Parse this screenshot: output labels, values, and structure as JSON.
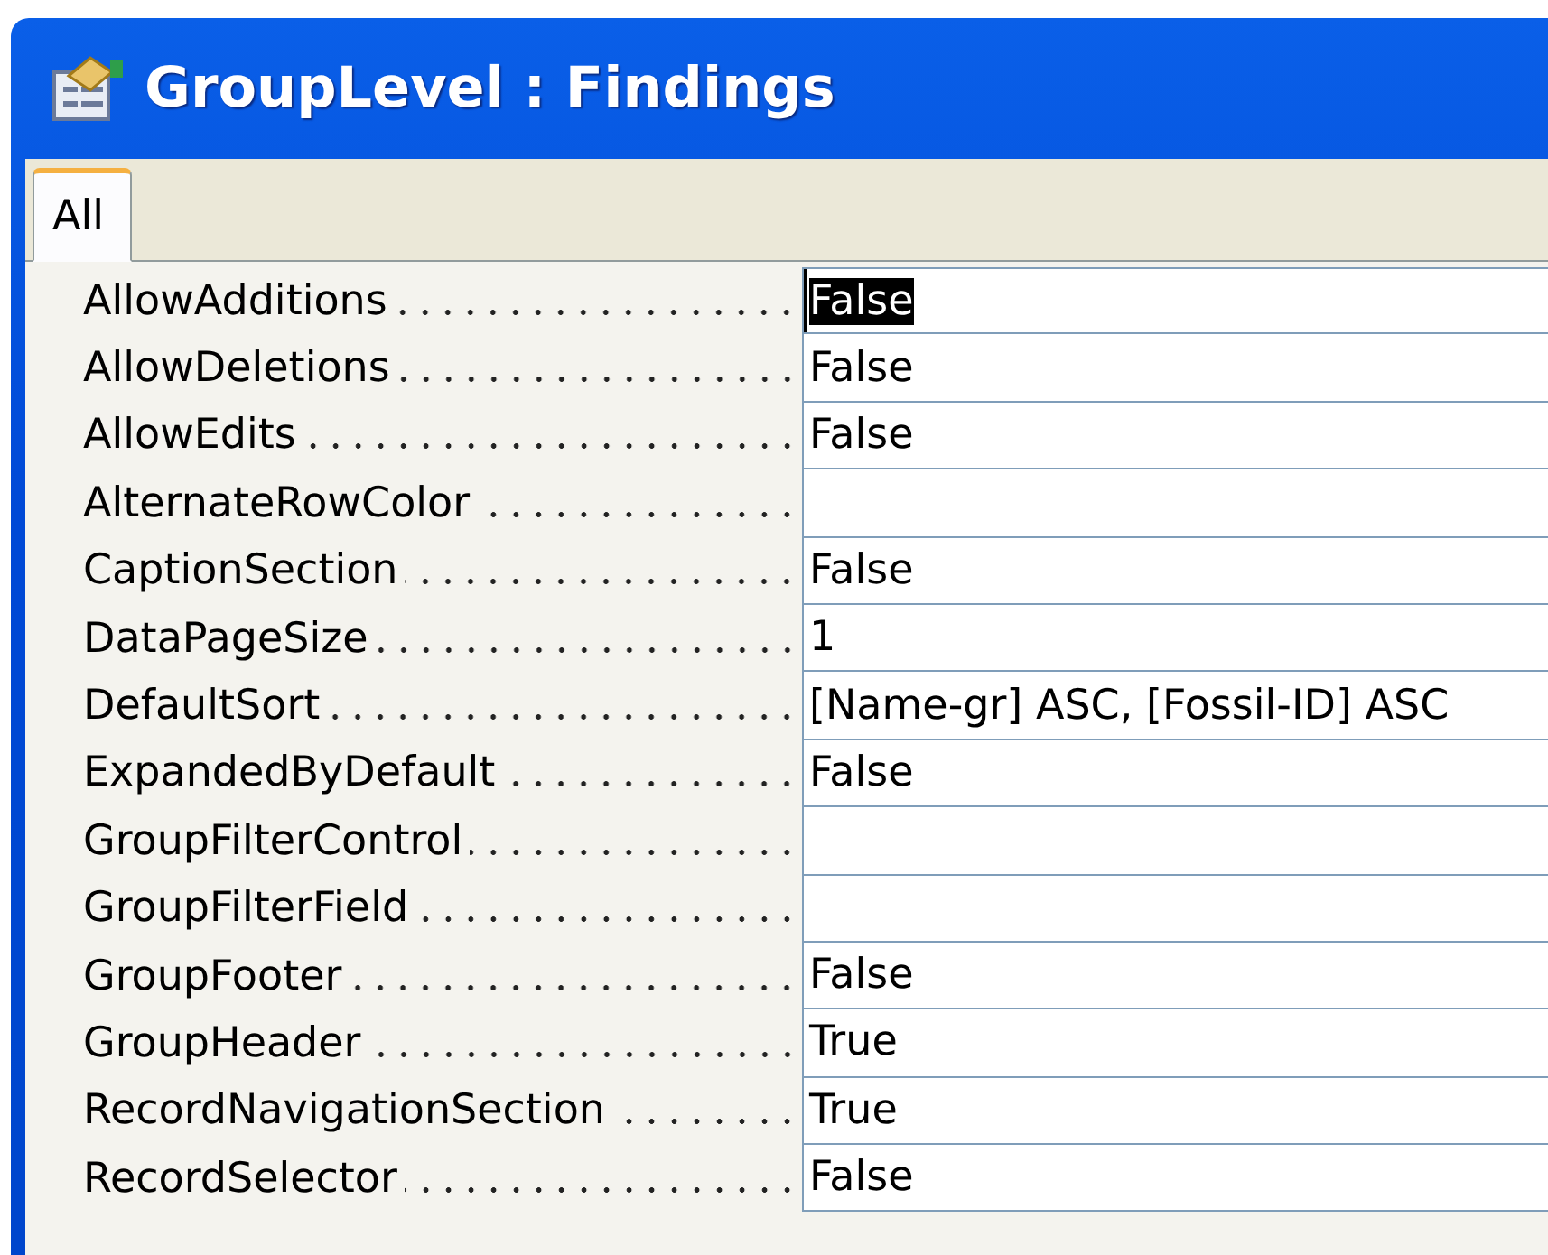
{
  "window": {
    "title": "GroupLevel : Findings"
  },
  "tabs": [
    {
      "label": "All",
      "selected": true
    }
  ],
  "properties": [
    {
      "name": "AllowAdditions",
      "value": "False",
      "selected": true
    },
    {
      "name": "AllowDeletions",
      "value": "False",
      "selected": false
    },
    {
      "name": "AllowEdits",
      "value": "False",
      "selected": false
    },
    {
      "name": "AlternateRowColor",
      "selected": false
    },
    {
      "name": "CaptionSection",
      "value": "False",
      "selected": false
    },
    {
      "name": "DataPageSize",
      "value": "1",
      "selected": false
    },
    {
      "name": "DefaultSort",
      "value": "[Name-gr] ASC, [Fossil-ID] ASC",
      "selected": false
    },
    {
      "name": "ExpandedByDefault",
      "value": "False",
      "selected": false
    },
    {
      "name": "GroupFilterControl",
      "selected": false
    },
    {
      "name": "GroupFilterField",
      "selected": false
    },
    {
      "name": "GroupFooter",
      "value": "False",
      "selected": false
    },
    {
      "name": "GroupHeader",
      "value": "True",
      "selected": false
    },
    {
      "name": "RecordNavigationSection",
      "value": "True",
      "selected": false
    },
    {
      "name": "RecordSelector",
      "value": "False",
      "selected": false
    }
  ]
}
